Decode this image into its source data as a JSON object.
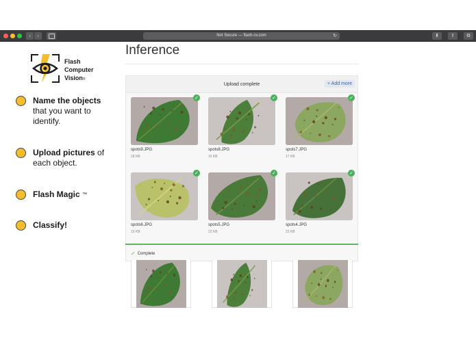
{
  "browser": {
    "url": "Not Secure — flash-cv.com",
    "back_glyph": "‹",
    "forward_glyph": "›",
    "reload_glyph": "↻",
    "download_glyph": "⬇",
    "share_glyph": "⇪",
    "tabs_glyph": "⧉"
  },
  "brand": {
    "line1": "Flash",
    "line2": "Computer",
    "line3": "Vision",
    "reg": "®",
    "accent": "#f5bd2e"
  },
  "steps": [
    {
      "bold": "Name the objects",
      "rest": "that you want to identify."
    },
    {
      "bold": "Upload pictures",
      "rest": "of each object."
    },
    {
      "bold": "Flash Magic",
      "tm": "™"
    },
    {
      "bold": "Classify!"
    }
  ],
  "page": {
    "title": "Inference"
  },
  "upload": {
    "header": "Upload complete",
    "add_more": "+ Add more",
    "check_glyph": "✓",
    "files": [
      {
        "name": "spots9.JPG",
        "size": "18 KB",
        "icon": "tomato-leaf-image"
      },
      {
        "name": "spots8.JPG",
        "size": "15 KB",
        "icon": "tomato-leaf-image"
      },
      {
        "name": "spots7.JPG",
        "size": "17 KB",
        "icon": "tomato-leaf-image"
      },
      {
        "name": "spots6.JPG",
        "size": "15 KB",
        "icon": "tomato-leaf-image"
      },
      {
        "name": "spots5.JPG",
        "size": "22 KB",
        "icon": "tomato-leaf-image"
      },
      {
        "name": "spots4.JPG",
        "size": "22 KB",
        "icon": "tomato-leaf-image"
      }
    ],
    "progress": 1.0,
    "status_tick": "✓",
    "status": "Complete",
    "accent": "#4cb05c"
  }
}
